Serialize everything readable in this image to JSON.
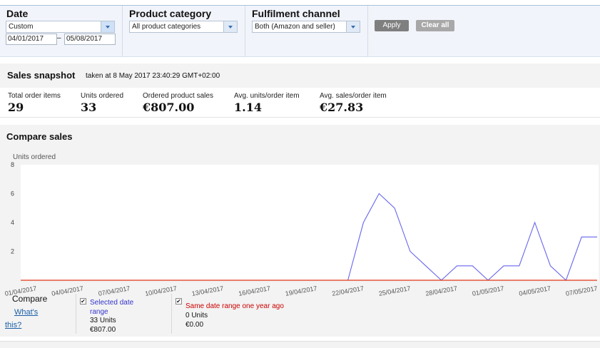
{
  "filters": {
    "date": {
      "label": "Date",
      "selected": "Custom",
      "from": "04/01/2017",
      "dash": "–",
      "to": "05/08/2017"
    },
    "category": {
      "label": "Product category",
      "selected": "All product categories"
    },
    "channel": {
      "label": "Fulfilment channel",
      "selected": "Both (Amazon and seller)"
    },
    "apply_label": "Apply",
    "clear_label": "Clear all"
  },
  "snapshot": {
    "title": "Sales snapshot",
    "taken": "taken at 8 May 2017 23:40:29 GMT+02:00",
    "metrics": [
      {
        "label": "Total order items",
        "value": "29"
      },
      {
        "label": "Units ordered",
        "value": "33"
      },
      {
        "label": "Ordered product sales",
        "value": "€807.00"
      },
      {
        "label": "Avg. units/order item",
        "value": "1.14"
      },
      {
        "label": "Avg. sales/order item",
        "value": "€27.83"
      }
    ]
  },
  "compare": {
    "title": "Compare sales",
    "legend": {
      "compare_label": "Compare",
      "whats_this": "What's this?",
      "selected": {
        "label": "Selected date range",
        "units": "33 Units",
        "sales": "€807.00",
        "color": "#3333cc"
      },
      "last_year": {
        "label": "Same date range one year ago",
        "units": "0 Units",
        "sales": "€0.00",
        "color": "#cc0000"
      }
    }
  },
  "chart_data": {
    "type": "line",
    "ylabel": "Units ordered",
    "ylim": [
      0,
      8
    ],
    "yticks": [
      2,
      4,
      6,
      8
    ],
    "x_tick_labels": [
      "01/04/2017",
      "04/04/2017",
      "07/04/2017",
      "10/04/2017",
      "13/04/2017",
      "16/04/2017",
      "19/04/2017",
      "22/04/2017",
      "25/04/2017",
      "28/04/2017",
      "01/05/2017",
      "04/05/2017",
      "07/05/2017"
    ],
    "x": [
      "01/04/2017",
      "02/04/2017",
      "03/04/2017",
      "04/04/2017",
      "05/04/2017",
      "06/04/2017",
      "07/04/2017",
      "08/04/2017",
      "09/04/2017",
      "10/04/2017",
      "11/04/2017",
      "12/04/2017",
      "13/04/2017",
      "14/04/2017",
      "15/04/2017",
      "16/04/2017",
      "17/04/2017",
      "18/04/2017",
      "19/04/2017",
      "20/04/2017",
      "21/04/2017",
      "22/04/2017",
      "23/04/2017",
      "24/04/2017",
      "25/04/2017",
      "26/04/2017",
      "27/04/2017",
      "28/04/2017",
      "29/04/2017",
      "30/04/2017",
      "01/05/2017",
      "02/05/2017",
      "03/05/2017",
      "04/05/2017",
      "05/05/2017",
      "06/05/2017",
      "07/05/2017",
      "08/05/2017"
    ],
    "series": [
      {
        "name": "Selected date range",
        "color": "#6666ee",
        "values": [
          0,
          0,
          0,
          0,
          0,
          0,
          0,
          0,
          0,
          0,
          0,
          0,
          0,
          0,
          0,
          0,
          0,
          0,
          0,
          0,
          0,
          0,
          4,
          6,
          5,
          2,
          1,
          0,
          1,
          1,
          0,
          1,
          1,
          4,
          1,
          0,
          3,
          3
        ]
      },
      {
        "name": "Same date range one year ago",
        "color": "#dd3311",
        "values": [
          0,
          0,
          0,
          0,
          0,
          0,
          0,
          0,
          0,
          0,
          0,
          0,
          0,
          0,
          0,
          0,
          0,
          0,
          0,
          0,
          0,
          0,
          0,
          0,
          0,
          0,
          0,
          0,
          0,
          0,
          0,
          0,
          0,
          0,
          0,
          0,
          0,
          0
        ]
      }
    ]
  }
}
